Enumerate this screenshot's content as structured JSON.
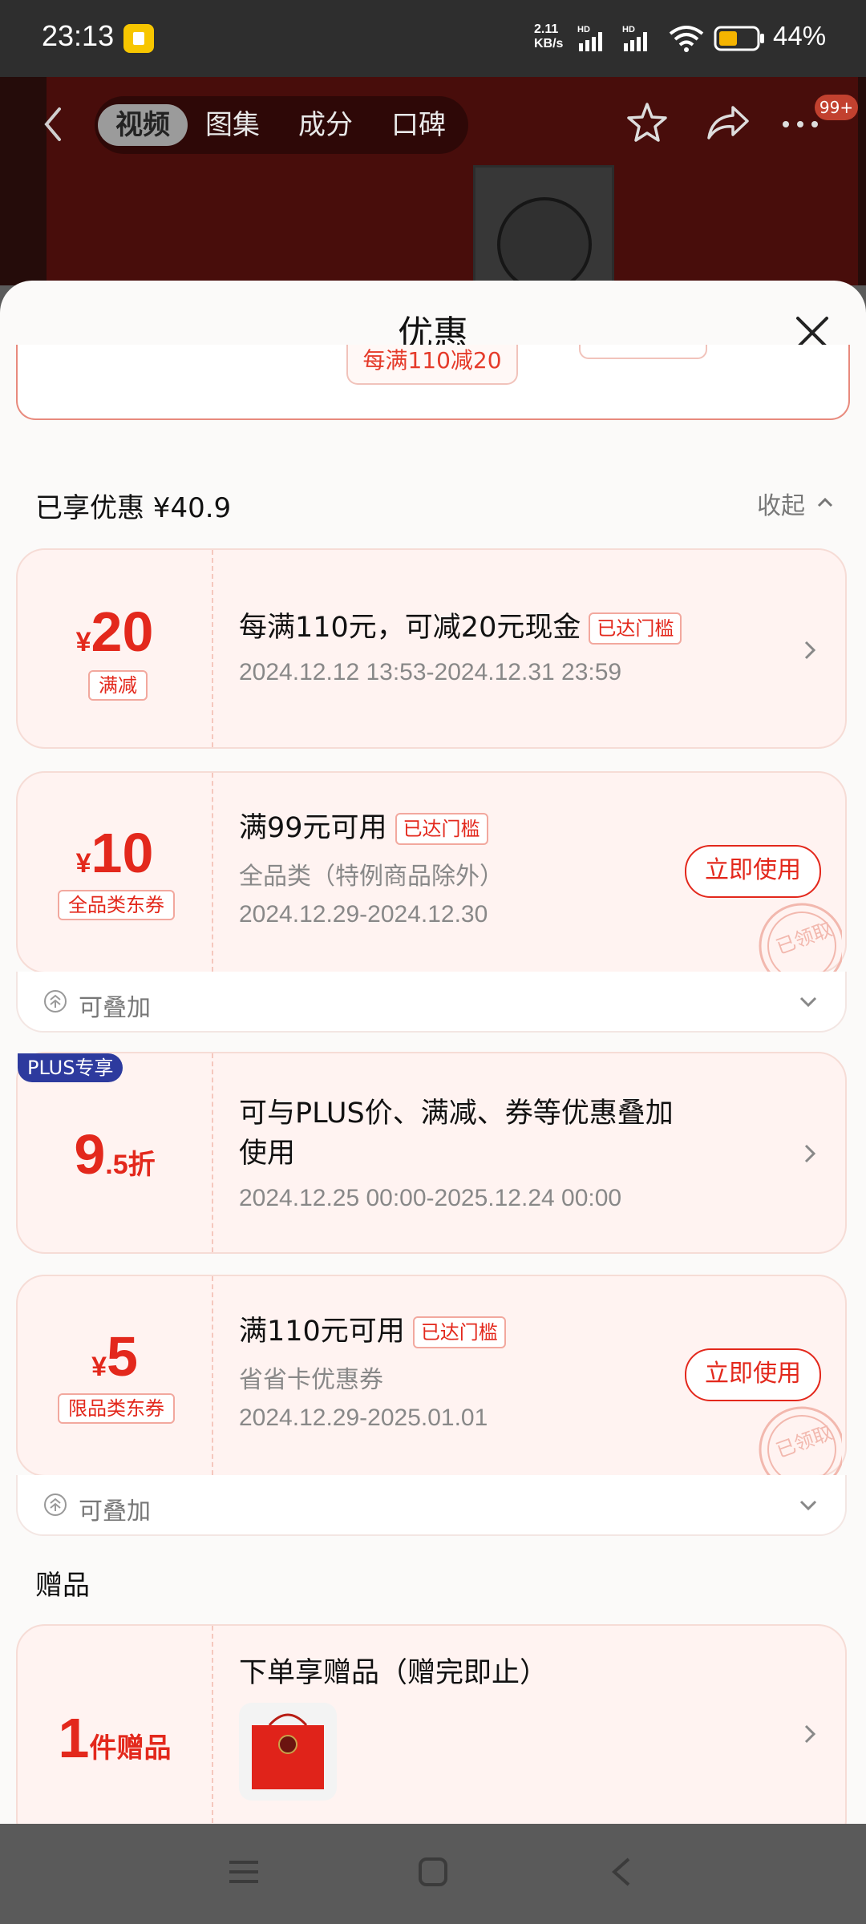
{
  "status_bar": {
    "time": "23:13",
    "net_speed_value": "2.11",
    "net_speed_unit": "KB/s",
    "battery": "44%",
    "signal_label": "HD"
  },
  "product_nav": {
    "tabs": [
      "视频",
      "图集",
      "成分",
      "口碑"
    ],
    "active_tab": "视频",
    "message_badge": "99+"
  },
  "sheet": {
    "title": "优惠",
    "remnant_tag": "每满110减20",
    "enjoyed_label": "已享优惠 ¥40.9",
    "collapse_label": "收起"
  },
  "coupons": [
    {
      "yen": "¥",
      "amount": "20",
      "type_badge": "满减",
      "title": "每满110元，可减20元现金",
      "reached": "已达门槛",
      "date": "2024.12.12 13:53-2024.12.31 23:59"
    },
    {
      "yen": "¥",
      "amount": "10",
      "type_badge": "全品类东券",
      "title": "满99元可用",
      "reached": "已达门槛",
      "subtitle": "全品类（特例商品除外）",
      "date": "2024.12.29-2024.12.30",
      "button": "立即使用",
      "stamp": "已领取",
      "stack_label": "可叠加"
    },
    {
      "plus_tag": "PLUS专享",
      "amount": "9",
      "amount_suffix": ".5折",
      "title_line1": "可与PLUS价、满减、券等优惠叠加",
      "title_line2": "使用",
      "date": "2024.12.25 00:00-2025.12.24 00:00"
    },
    {
      "yen": "¥",
      "amount": "5",
      "type_badge": "限品类东券",
      "title": "满110元可用",
      "reached": "已达门槛",
      "subtitle": "省省卡优惠券",
      "date": "2024.12.29-2025.01.01",
      "button": "立即使用",
      "stamp": "已领取",
      "stack_label": "可叠加"
    }
  ],
  "gift": {
    "heading": "赠品",
    "count": "1",
    "count_suffix": "件赠品",
    "title": "下单享赠品（赠完即止）"
  },
  "colors": {
    "accent_red": "#e3281c",
    "card_bg": "#fff3f1",
    "plus_blue": "#2d3a9e"
  }
}
